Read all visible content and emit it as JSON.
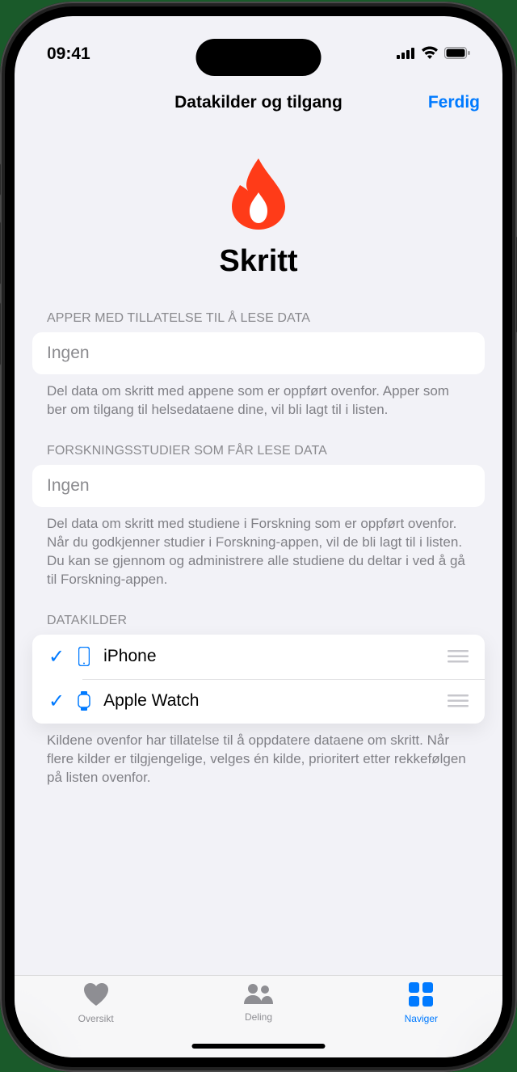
{
  "status": {
    "time": "09:41"
  },
  "nav": {
    "title": "Datakilder og tilgang",
    "done": "Ferdig"
  },
  "hero": {
    "title": "Skritt"
  },
  "sections": {
    "apps": {
      "header": "APPER MED TILLATELSE TIL Å LESE DATA",
      "value": "Ingen",
      "footer": "Del data om skritt med appene som er oppført ovenfor. Apper som ber om tilgang til helsedataene dine, vil bli lagt til i listen."
    },
    "studies": {
      "header": "FORSKNINGSSTUDIER SOM FÅR LESE DATA",
      "value": "Ingen",
      "footer": "Del data om skritt med studiene i Forskning som er oppført ovenfor. Når du godkjenner studier i Forskning-appen, vil de bli lagt til i listen. Du kan se gjennom og administrere alle studiene du deltar i ved å gå til Forskning-appen."
    },
    "sources": {
      "header": "DATAKILDER",
      "items": [
        {
          "name": "iPhone",
          "checked": true
        },
        {
          "name": "Apple Watch",
          "checked": true
        }
      ],
      "footer": "Kildene ovenfor har tillatelse til å oppdatere dataene om skritt. Når flere kilder er tilgjengelige, velges én kilde, prioritert etter rekkefølgen på listen ovenfor."
    }
  },
  "tabs": {
    "summary": "Oversikt",
    "sharing": "Deling",
    "browse": "Naviger"
  }
}
